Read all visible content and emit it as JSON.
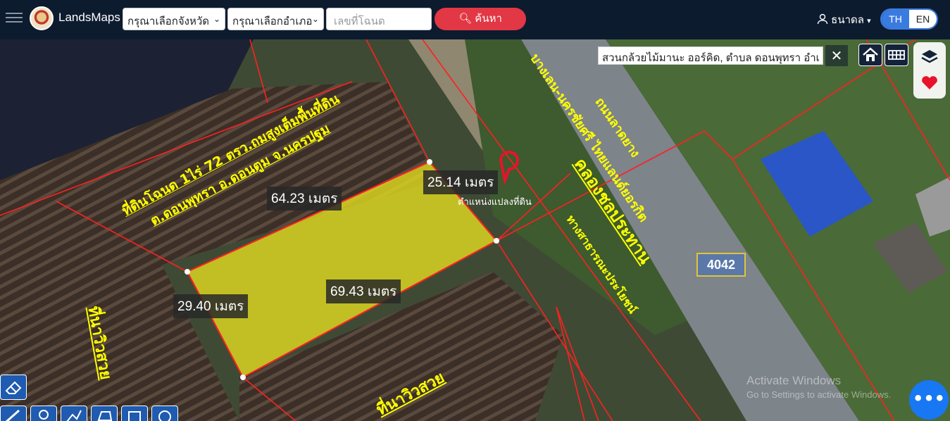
{
  "app": {
    "brand": "LandsMaps"
  },
  "header": {
    "province_select": "กรุณาเลือกจังหวัด",
    "amphoe_select": "กรุณาเลือกอำเภอ",
    "deed_placeholder": "เลขที่โฉนด",
    "search_label": "ค้นหา",
    "user_name": "ธนาดล",
    "lang_th": "TH",
    "lang_en": "EN"
  },
  "map": {
    "search_text": "สวนกล้วยไม้มานะ ออร์คิด, ตำบล ดอนพุทรา อำเ",
    "pin_label": "ตำแหน่งแปลงที่ดิน",
    "road_number": "4042",
    "measurements": {
      "top": "64.23 เมตร",
      "right": "25.14 เมตร",
      "bottom": "69.43 เมตร",
      "left": "29.40 เมตร"
    },
    "annotations": {
      "land_title": "ที่ดินโฉนด 1ไร่ 72 ตรว.ถมสูงเต็มพื้นที่ดิน",
      "land_location": "ต.ดอนพุทรา อ.ดอนตูม จ.นครปฐม",
      "road_name": "ถนนลาดยาง",
      "road_route": "บางเลน-นครชัยศรี ไทยแลนด์ยอรกิต",
      "canal": "คลองชลประทาน",
      "public_way": "ทางสาธารณะประโยชน์",
      "field_left": "ที่นาวิวสวย",
      "field_bottom": "ที่นาวิวสวย"
    },
    "watermark": {
      "line1": "Activate Windows",
      "line2": "Go to Settings to activate Windows."
    }
  },
  "colors": {
    "topbar": "#0d1b2f",
    "accent_red": "#e23744",
    "accent_blue": "#3a7be0",
    "parcel_fill": "#e6e01f",
    "boundary": "#ff2020",
    "annotation": "#ffff00"
  },
  "icons": {
    "menu": "hamburger-icon",
    "search": "search-icon",
    "user": "user-icon",
    "home": "home-icon",
    "grid": "grid-icon",
    "layers": "layers-icon",
    "favorite": "heart-icon",
    "chat": "chat-icon"
  }
}
